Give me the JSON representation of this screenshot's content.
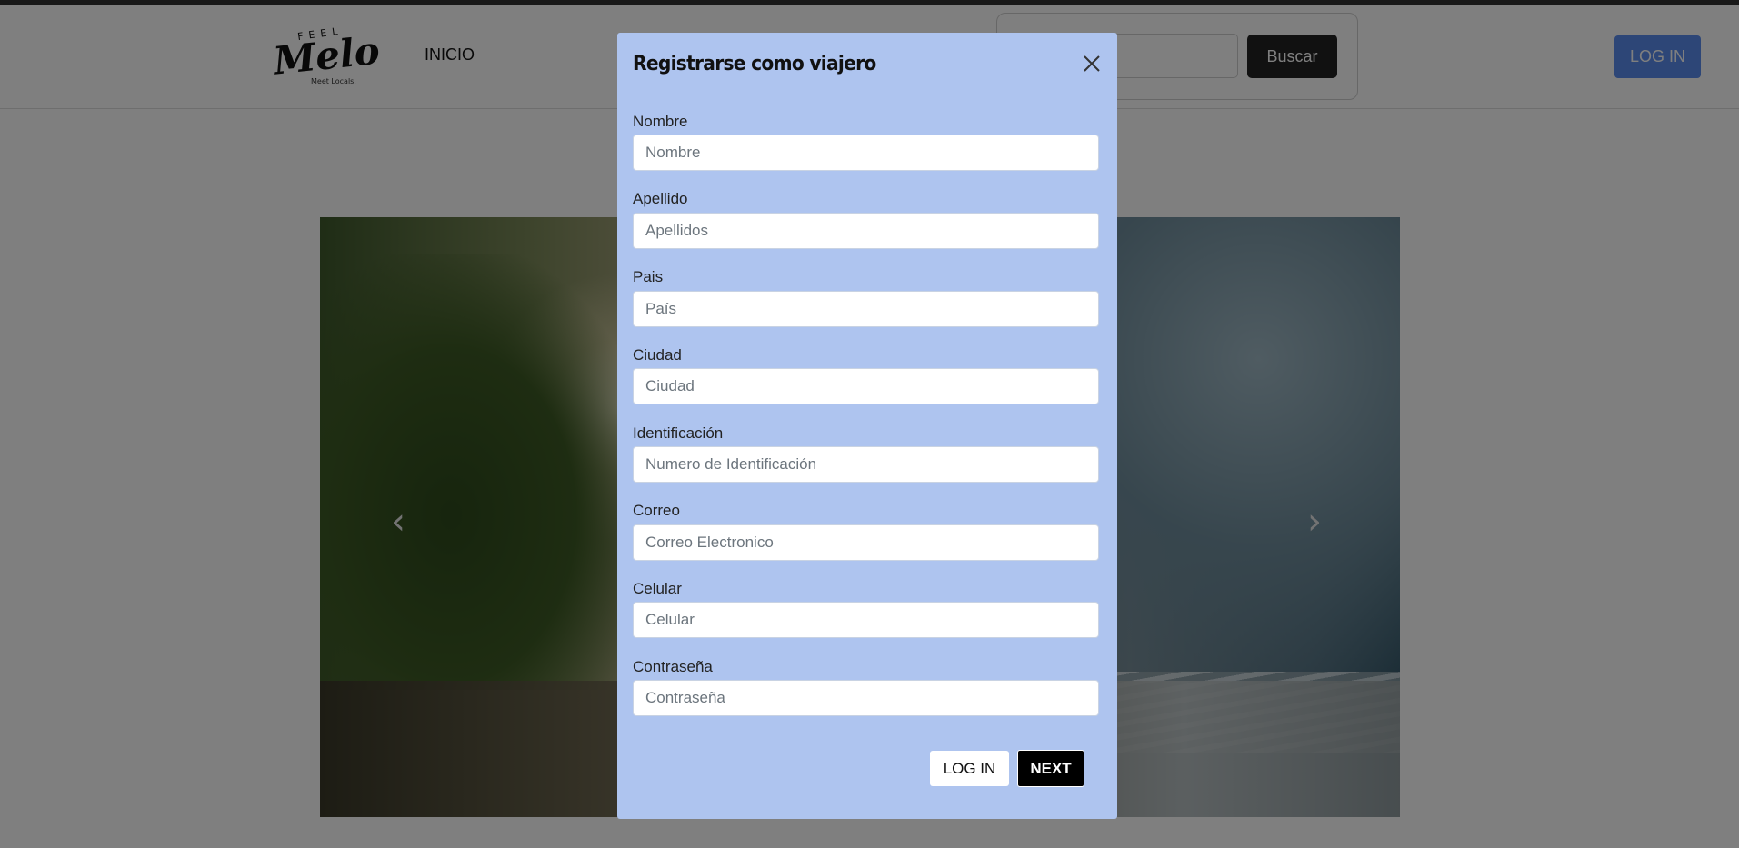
{
  "navbar": {
    "logo_top_text": "FEEL",
    "logo_script_text": "Melo",
    "logo_tagline": "Meet Locals.",
    "nav_link": "INICIO",
    "search_button": "Buscar",
    "login_button": "LOG IN"
  },
  "carousel": {
    "prev_icon": "‹",
    "next_icon": "›"
  },
  "modal": {
    "title": "Registrarse como viajero",
    "close_icon": "close-icon",
    "fields": [
      {
        "label": "Nombre",
        "placeholder": "Nombre"
      },
      {
        "label": "Apellido",
        "placeholder": "Apellidos"
      },
      {
        "label": "Pais",
        "placeholder": "País"
      },
      {
        "label": "Ciudad",
        "placeholder": "Ciudad"
      },
      {
        "label": "Identificación",
        "placeholder": "Numero de Identificación"
      },
      {
        "label": "Correo",
        "placeholder": "Correo Electronico"
      },
      {
        "label": "Celular",
        "placeholder": "Celular"
      },
      {
        "label": "Contraseña",
        "placeholder": "Contraseña"
      }
    ],
    "login_button": "LOG IN",
    "next_button": "NEXT"
  },
  "colors": {
    "modal_bg": "#aec4ef",
    "login_top_bg": "#5b8def",
    "search_button_bg": "#222222",
    "next_button_bg": "#000000"
  }
}
